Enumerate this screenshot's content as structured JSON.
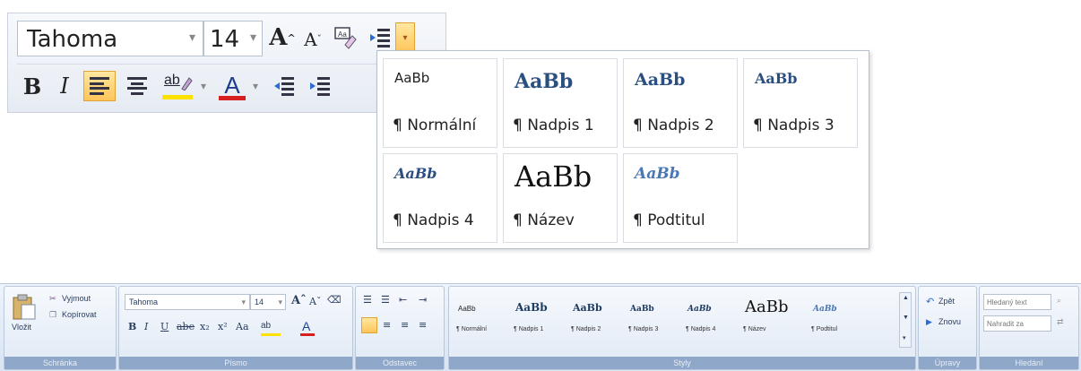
{
  "mini_toolbar": {
    "font_name": "Tahoma",
    "font_size": "14",
    "grow_font": "A",
    "shrink_font": "A",
    "bold": "B",
    "italic": "I",
    "font_color": "A",
    "highlight_text": "ab"
  },
  "styles_gallery": {
    "tiles": [
      {
        "preview": "AaBb",
        "name": "¶ Normální"
      },
      {
        "preview": "AaBb",
        "name": "¶ Nadpis 1"
      },
      {
        "preview": "AaBb",
        "name": "¶ Nadpis 2"
      },
      {
        "preview": "AaBb",
        "name": "¶ Nadpis 3"
      },
      {
        "preview": "AaBb",
        "name": "¶ Nadpis 4"
      },
      {
        "preview": "AaBb",
        "name": "¶ Název"
      },
      {
        "preview": "AaBb",
        "name": "¶ Podtitul"
      }
    ]
  },
  "ribbon": {
    "clipboard": {
      "paste": "Vložit",
      "cut": "Vyjmout",
      "copy": "Kopírovat",
      "label": "Schránka"
    },
    "font": {
      "font_name": "Tahoma",
      "font_size": "14",
      "bold": "B",
      "italic": "I",
      "underline": "U",
      "strike": "abe",
      "subscript": "x₂",
      "superscript": "x²",
      "change_case": "Aa",
      "label": "Písmo"
    },
    "paragraph": {
      "label": "Odstavec"
    },
    "styles": {
      "label": "Styly",
      "tiles": [
        {
          "preview": "AaBb",
          "name": "¶ Normální"
        },
        {
          "preview": "AaBb",
          "name": "¶ Nadpis 1"
        },
        {
          "preview": "AaBb",
          "name": "¶ Nadpis 2"
        },
        {
          "preview": "AaBb",
          "name": "¶ Nadpis 3"
        },
        {
          "preview": "AaBb",
          "name": "¶ Nadpis 4"
        },
        {
          "preview": "AaBb",
          "name": "¶ Název"
        },
        {
          "preview": "AaBb",
          "name": "¶ Podtitul"
        }
      ]
    },
    "editing": {
      "undo": "Zpět",
      "redo": "Znovu",
      "label": "Úpravy"
    },
    "find": {
      "find_placeholder": "Hledaný text",
      "replace_placeholder": "Nahradit za",
      "label": "Hledání"
    }
  },
  "colors": {
    "accent_active": "#ffc55a",
    "font_color_bar": "#d62020",
    "highlight_bar": "#ffe100",
    "ribbon_label_bg": "#8fa7c8"
  }
}
